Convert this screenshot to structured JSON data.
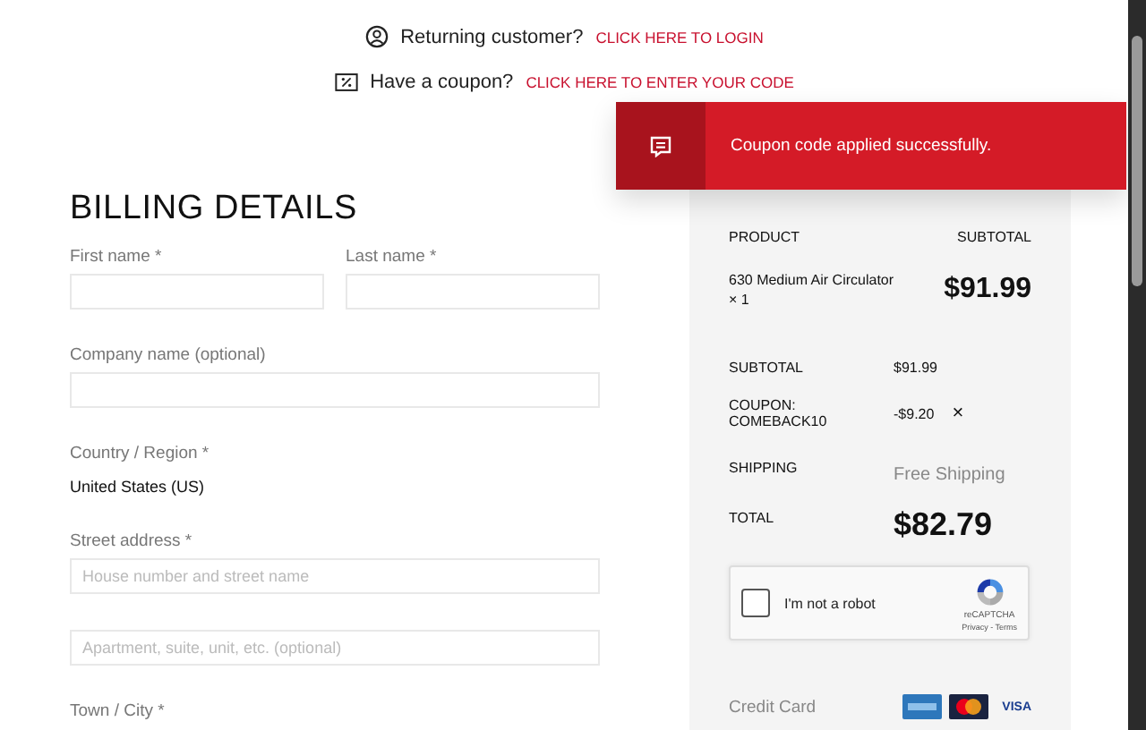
{
  "notices": [
    {
      "kind": "login",
      "text": "Returning customer?",
      "link": "CLICK HERE TO LOGIN"
    },
    {
      "kind": "coupon",
      "text": "Have a coupon?",
      "link": "CLICK HERE TO ENTER YOUR CODE"
    }
  ],
  "toast": {
    "message": "Coupon code applied successfully."
  },
  "billing": {
    "title": "BILLING DETAILS",
    "rows": [
      {
        "fields": [
          {
            "kind": "input",
            "label": "First name *"
          },
          {
            "kind": "input",
            "label": "Last name *"
          }
        ]
      },
      {
        "fields": [
          {
            "kind": "input",
            "label": "Company name (optional)"
          }
        ]
      },
      {
        "fields": [
          {
            "kind": "static",
            "label": "Country / Region *",
            "value": "United States (US)"
          }
        ]
      },
      {
        "fields": [
          {
            "kind": "input",
            "label": "Street address *",
            "placeholder": "House number and street name"
          }
        ]
      },
      {
        "fields": [
          {
            "kind": "input",
            "placeholder": "Apartment, suite, unit, etc. (optional)"
          }
        ]
      },
      {
        "fields": [
          {
            "kind": "label",
            "label": "Town / City *"
          }
        ]
      }
    ]
  },
  "order": {
    "product_heading": "PRODUCT",
    "subtotal_heading": "SUBTOTAL",
    "items": [
      {
        "name": "630 Medium Air Circulator",
        "quantity": "× 1",
        "price": "$91.99"
      }
    ],
    "subtotal_label": "SUBTOTAL",
    "subtotal": "$91.99",
    "coupon_label": "COUPON: COMEBACK10",
    "coupon_amount": "-$9.20",
    "coupon_remove": "×",
    "shipping_label": "SHIPPING",
    "shipping": "Free Shipping",
    "total_label": "TOTAL",
    "total": "$82.79"
  },
  "captcha": {
    "label": "I'm not a robot",
    "checked": false,
    "brand": "reCAPTCHA",
    "links": "Privacy - Terms"
  },
  "payment": {
    "label": "Credit Card",
    "cards": [
      {
        "kind": "amex"
      },
      {
        "kind": "mastercard"
      },
      {
        "kind": "visa",
        "text": "VISA"
      }
    ]
  }
}
